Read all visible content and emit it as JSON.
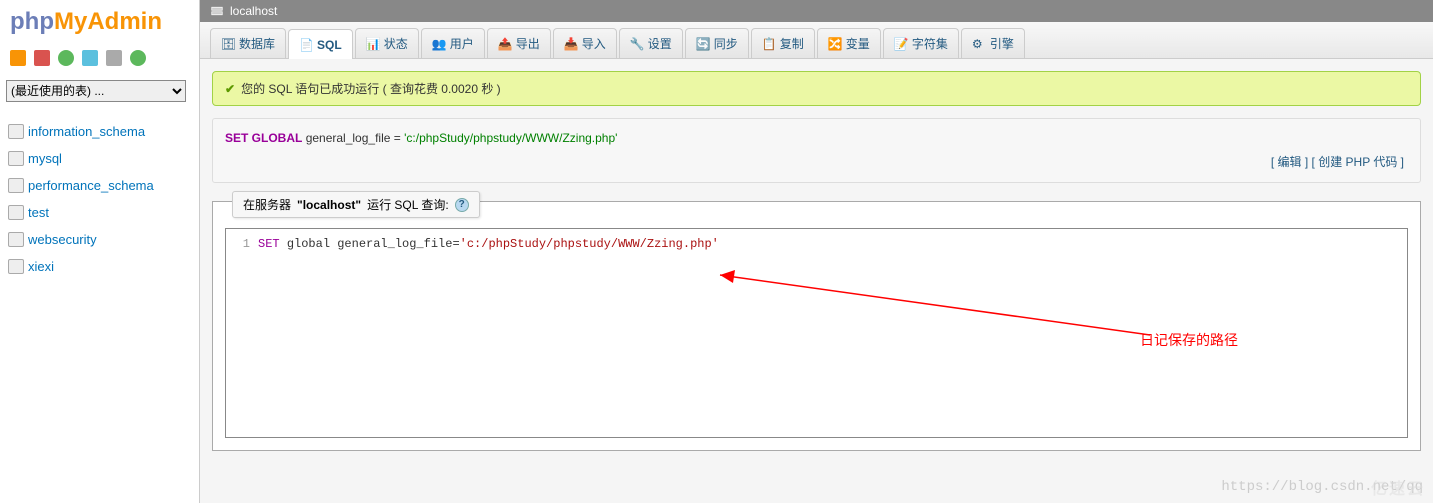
{
  "logo": {
    "part1": "php",
    "part2": "My",
    "part3": "Admin"
  },
  "recent_select": {
    "label": "(最近使用的表) ..."
  },
  "databases": [
    "information_schema",
    "mysql",
    "performance_schema",
    "test",
    "websecurity",
    "xiexi"
  ],
  "breadcrumb": {
    "host": "localhost"
  },
  "tabs": [
    {
      "label": "数据库",
      "icon": "database-icon"
    },
    {
      "label": "SQL",
      "icon": "sql-icon",
      "active": true
    },
    {
      "label": "状态",
      "icon": "status-icon"
    },
    {
      "label": "用户",
      "icon": "users-icon"
    },
    {
      "label": "导出",
      "icon": "export-icon"
    },
    {
      "label": "导入",
      "icon": "import-icon"
    },
    {
      "label": "设置",
      "icon": "settings-icon"
    },
    {
      "label": "同步",
      "icon": "sync-icon"
    },
    {
      "label": "复制",
      "icon": "copy-icon"
    },
    {
      "label": "变量",
      "icon": "vars-icon"
    },
    {
      "label": "字符集",
      "icon": "charset-icon"
    },
    {
      "label": "引擎",
      "icon": "engine-icon"
    }
  ],
  "success": {
    "message": "您的 SQL 语句已成功运行 ( 查询花费 0.0020 秒 )"
  },
  "sql_display": {
    "kw1": "SET GLOBAL",
    "ident": "general_log_file =",
    "str": "'c:/phpStudy/phpstudy/WWW/Zzing.php'"
  },
  "action_links": {
    "edit": "编辑",
    "create_php": "创建 PHP 代码"
  },
  "query_box": {
    "prefix": "在服务器",
    "host": "\"localhost\"",
    "suffix": "运行 SQL 查询:"
  },
  "editor": {
    "line_no": "1",
    "kw": "SET",
    "rest": "global general_log_file=",
    "str": "'c:/phpStudy/phpstudy/WWW/Zzing.php'"
  },
  "annotation": "日记保存的路径",
  "watermark1": "https://blog.csdn.net/qq",
  "watermark2": "亿速云"
}
